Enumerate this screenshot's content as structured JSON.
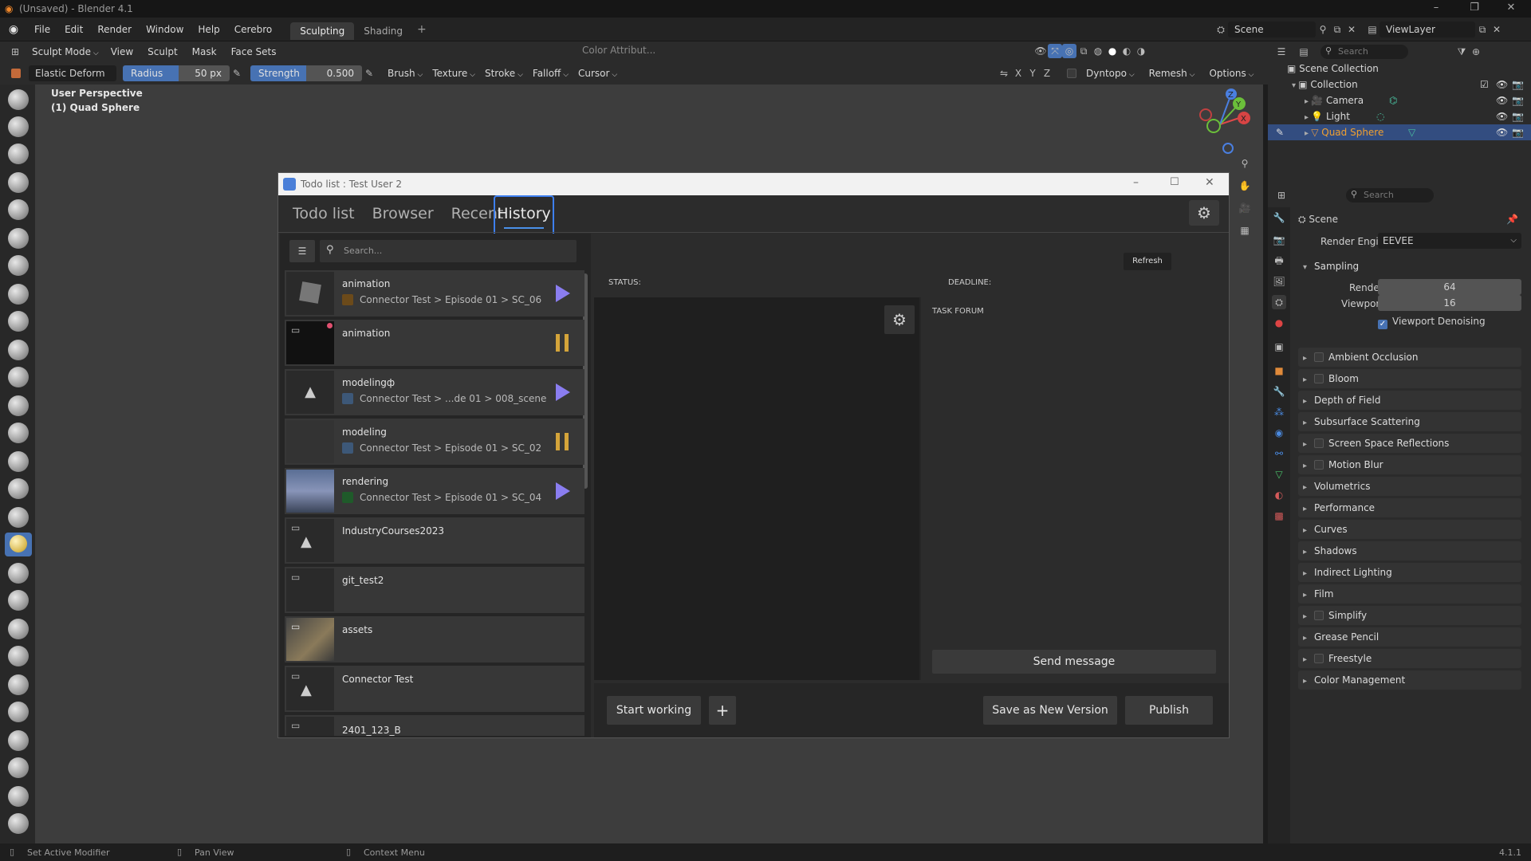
{
  "titlebar": {
    "title": "(Unsaved) - Blender 4.1"
  },
  "menubar": {
    "menus": [
      "File",
      "Edit",
      "Render",
      "Window",
      "Help",
      "Cerebro"
    ],
    "workspace_tabs": [
      "Sculpting",
      "Shading"
    ],
    "active_tab": "Sculpting",
    "scene": "Scene",
    "view_layer": "ViewLayer"
  },
  "header": {
    "mode": "Sculpt Mode",
    "menus": [
      "View",
      "Sculpt",
      "Mask",
      "Face Sets"
    ],
    "color_attr": "Color Attribut...",
    "search_placeholder": "Search"
  },
  "tool_header": {
    "brush": "Elastic Deform",
    "radius_label": "Radius",
    "radius_value": "50 px",
    "strength_label": "Strength",
    "strength_value": "0.500",
    "dropdowns": [
      "Brush",
      "Texture",
      "Stroke",
      "Falloff",
      "Cursor"
    ],
    "axes": [
      "X",
      "Y",
      "Z"
    ],
    "dyntopo": "Dyntopo",
    "remesh": "Remesh",
    "options": "Options"
  },
  "viewport": {
    "line1": "User Perspective",
    "line2": "(1) Quad Sphere",
    "gizmo": {
      "x": "X",
      "y": "Y",
      "z": "Z"
    }
  },
  "dialog": {
    "title": "Todo list : Test User 2",
    "tabs": [
      "Todo list",
      "Browser",
      "Recent",
      "History"
    ],
    "active_tab": "History",
    "search_placeholder": "Search...",
    "items": [
      {
        "name": "animation",
        "path": "Connector Test > Episode 01 > SC_06",
        "swatch": "#6b4a1a",
        "state": "play"
      },
      {
        "name": "animation",
        "path": "",
        "swatch": "",
        "state": "pause"
      },
      {
        "name": "modelingф",
        "path": "Connector Test > ...de 01 > 008_scene",
        "swatch": "#3d5878",
        "state": "play"
      },
      {
        "name": "modeling",
        "path": "Connector Test > Episode 01 > SC_02",
        "swatch": "#3d5878",
        "state": "pause"
      },
      {
        "name": "rendering",
        "path": "Connector Test > Episode 01 > SC_04",
        "swatch": "#1f5a2a",
        "state": "play"
      },
      {
        "name": "IndustryCourses2023",
        "path": "",
        "swatch": "",
        "state": ""
      },
      {
        "name": "git_test2",
        "path": "",
        "swatch": "",
        "state": ""
      },
      {
        "name": "assets",
        "path": "",
        "swatch": "",
        "state": ""
      },
      {
        "name": "Connector Test",
        "path": "",
        "swatch": "",
        "state": ""
      },
      {
        "name": "2401_123_B",
        "path": "",
        "swatch": "",
        "state": ""
      }
    ],
    "refresh": "Refresh",
    "status_label": "STATUS:",
    "deadline_label": "DEADLINE:",
    "task_forum": "TASK FORUM",
    "send_message": "Send message",
    "start_working": "Start working",
    "save_new_version": "Save as New Version",
    "publish": "Publish"
  },
  "outliner": {
    "search_placeholder": "Search",
    "scene_collection": "Scene Collection",
    "collection": "Collection",
    "objects": [
      {
        "name": "Camera",
        "selected": false
      },
      {
        "name": "Light",
        "selected": false
      },
      {
        "name": "Quad Sphere",
        "selected": true
      }
    ]
  },
  "properties": {
    "search_placeholder": "Search",
    "context": "Scene",
    "render_engine_label": "Render Engine",
    "render_engine": "EEVEE",
    "sampling": "Sampling",
    "render_label": "Render",
    "render_value": "64",
    "viewport_label": "Viewport",
    "viewport_value": "16",
    "viewport_denoising": "Viewport Denoising",
    "panels": [
      {
        "label": "Ambient Occlusion",
        "checkbox": true
      },
      {
        "label": "Bloom",
        "checkbox": true
      },
      {
        "label": "Depth of Field",
        "checkbox": false
      },
      {
        "label": "Subsurface Scattering",
        "checkbox": false
      },
      {
        "label": "Screen Space Reflections",
        "checkbox": true
      },
      {
        "label": "Motion Blur",
        "checkbox": true
      },
      {
        "label": "Volumetrics",
        "checkbox": false
      },
      {
        "label": "Performance",
        "checkbox": false
      },
      {
        "label": "Curves",
        "checkbox": false
      },
      {
        "label": "Shadows",
        "checkbox": false
      },
      {
        "label": "Indirect Lighting",
        "checkbox": false
      },
      {
        "label": "Film",
        "checkbox": false
      },
      {
        "label": "Simplify",
        "checkbox": true
      },
      {
        "label": "Grease Pencil",
        "checkbox": false
      },
      {
        "label": "Freestyle",
        "checkbox": true
      },
      {
        "label": "Color Management",
        "checkbox": false
      }
    ]
  },
  "statusbar": {
    "left": "Set Active Modifier",
    "middle": "Pan View",
    "right": "Context Menu",
    "version": "4.1.1"
  },
  "colors": {
    "accent": "#4772b3",
    "play": "#8a7df0",
    "pause": "#d4a43a",
    "selected_text": "#f0a030"
  }
}
